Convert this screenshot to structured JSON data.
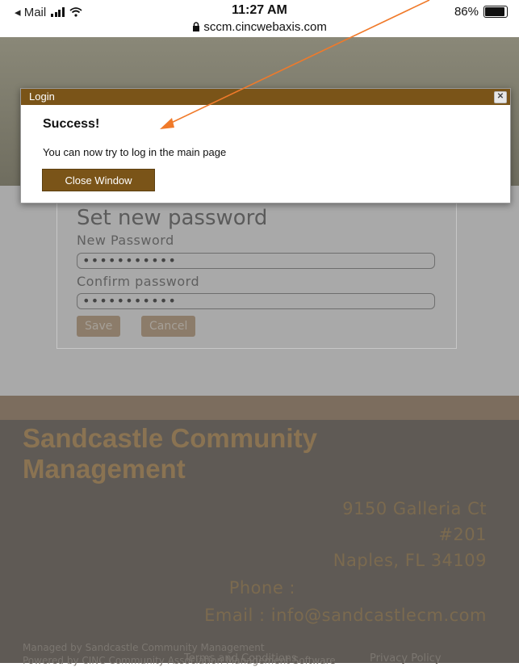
{
  "status_bar": {
    "back_app": "◂ Mail",
    "time": "11:27 AM",
    "url": "sccm.cincwebaxis.com",
    "battery_percent": "86%",
    "battery_level": 0.86
  },
  "modal": {
    "title": "Login",
    "close_glyph": "✕",
    "heading": "Success!",
    "message": "You can now try to log in the main page",
    "close_button": "Close Window"
  },
  "form": {
    "title": "Set new password",
    "new_password_label": "New Password",
    "new_password_value": "•••••••••••",
    "confirm_password_label": "Confirm password",
    "confirm_password_value": "•••••••••••",
    "save": "Save",
    "cancel": "Cancel"
  },
  "footer": {
    "company_line1": "Sandcastle Community",
    "company_line2": "Management",
    "address_line1": "9150 Galleria Ct",
    "address_line2": "#201",
    "address_line3": "Naples, FL 34109",
    "phone": "Phone :",
    "email": "Email : info@sandcastlecm.com",
    "managed_by": "Managed by Sandcastle Community Management",
    "powered_by": "Powered by CINC Community Association Management Software",
    "terms": "Terms and Conditions",
    "privacy": "Privacy Policy"
  },
  "colors": {
    "modal_header": "#7a5418",
    "annotation_arrow": "#f07a2a",
    "footer_bg": "#5f5a55",
    "brand_text": "#8a7352"
  },
  "icons": [
    "signal-icon",
    "wifi-icon",
    "lock-icon",
    "battery-icon",
    "close-icon"
  ]
}
